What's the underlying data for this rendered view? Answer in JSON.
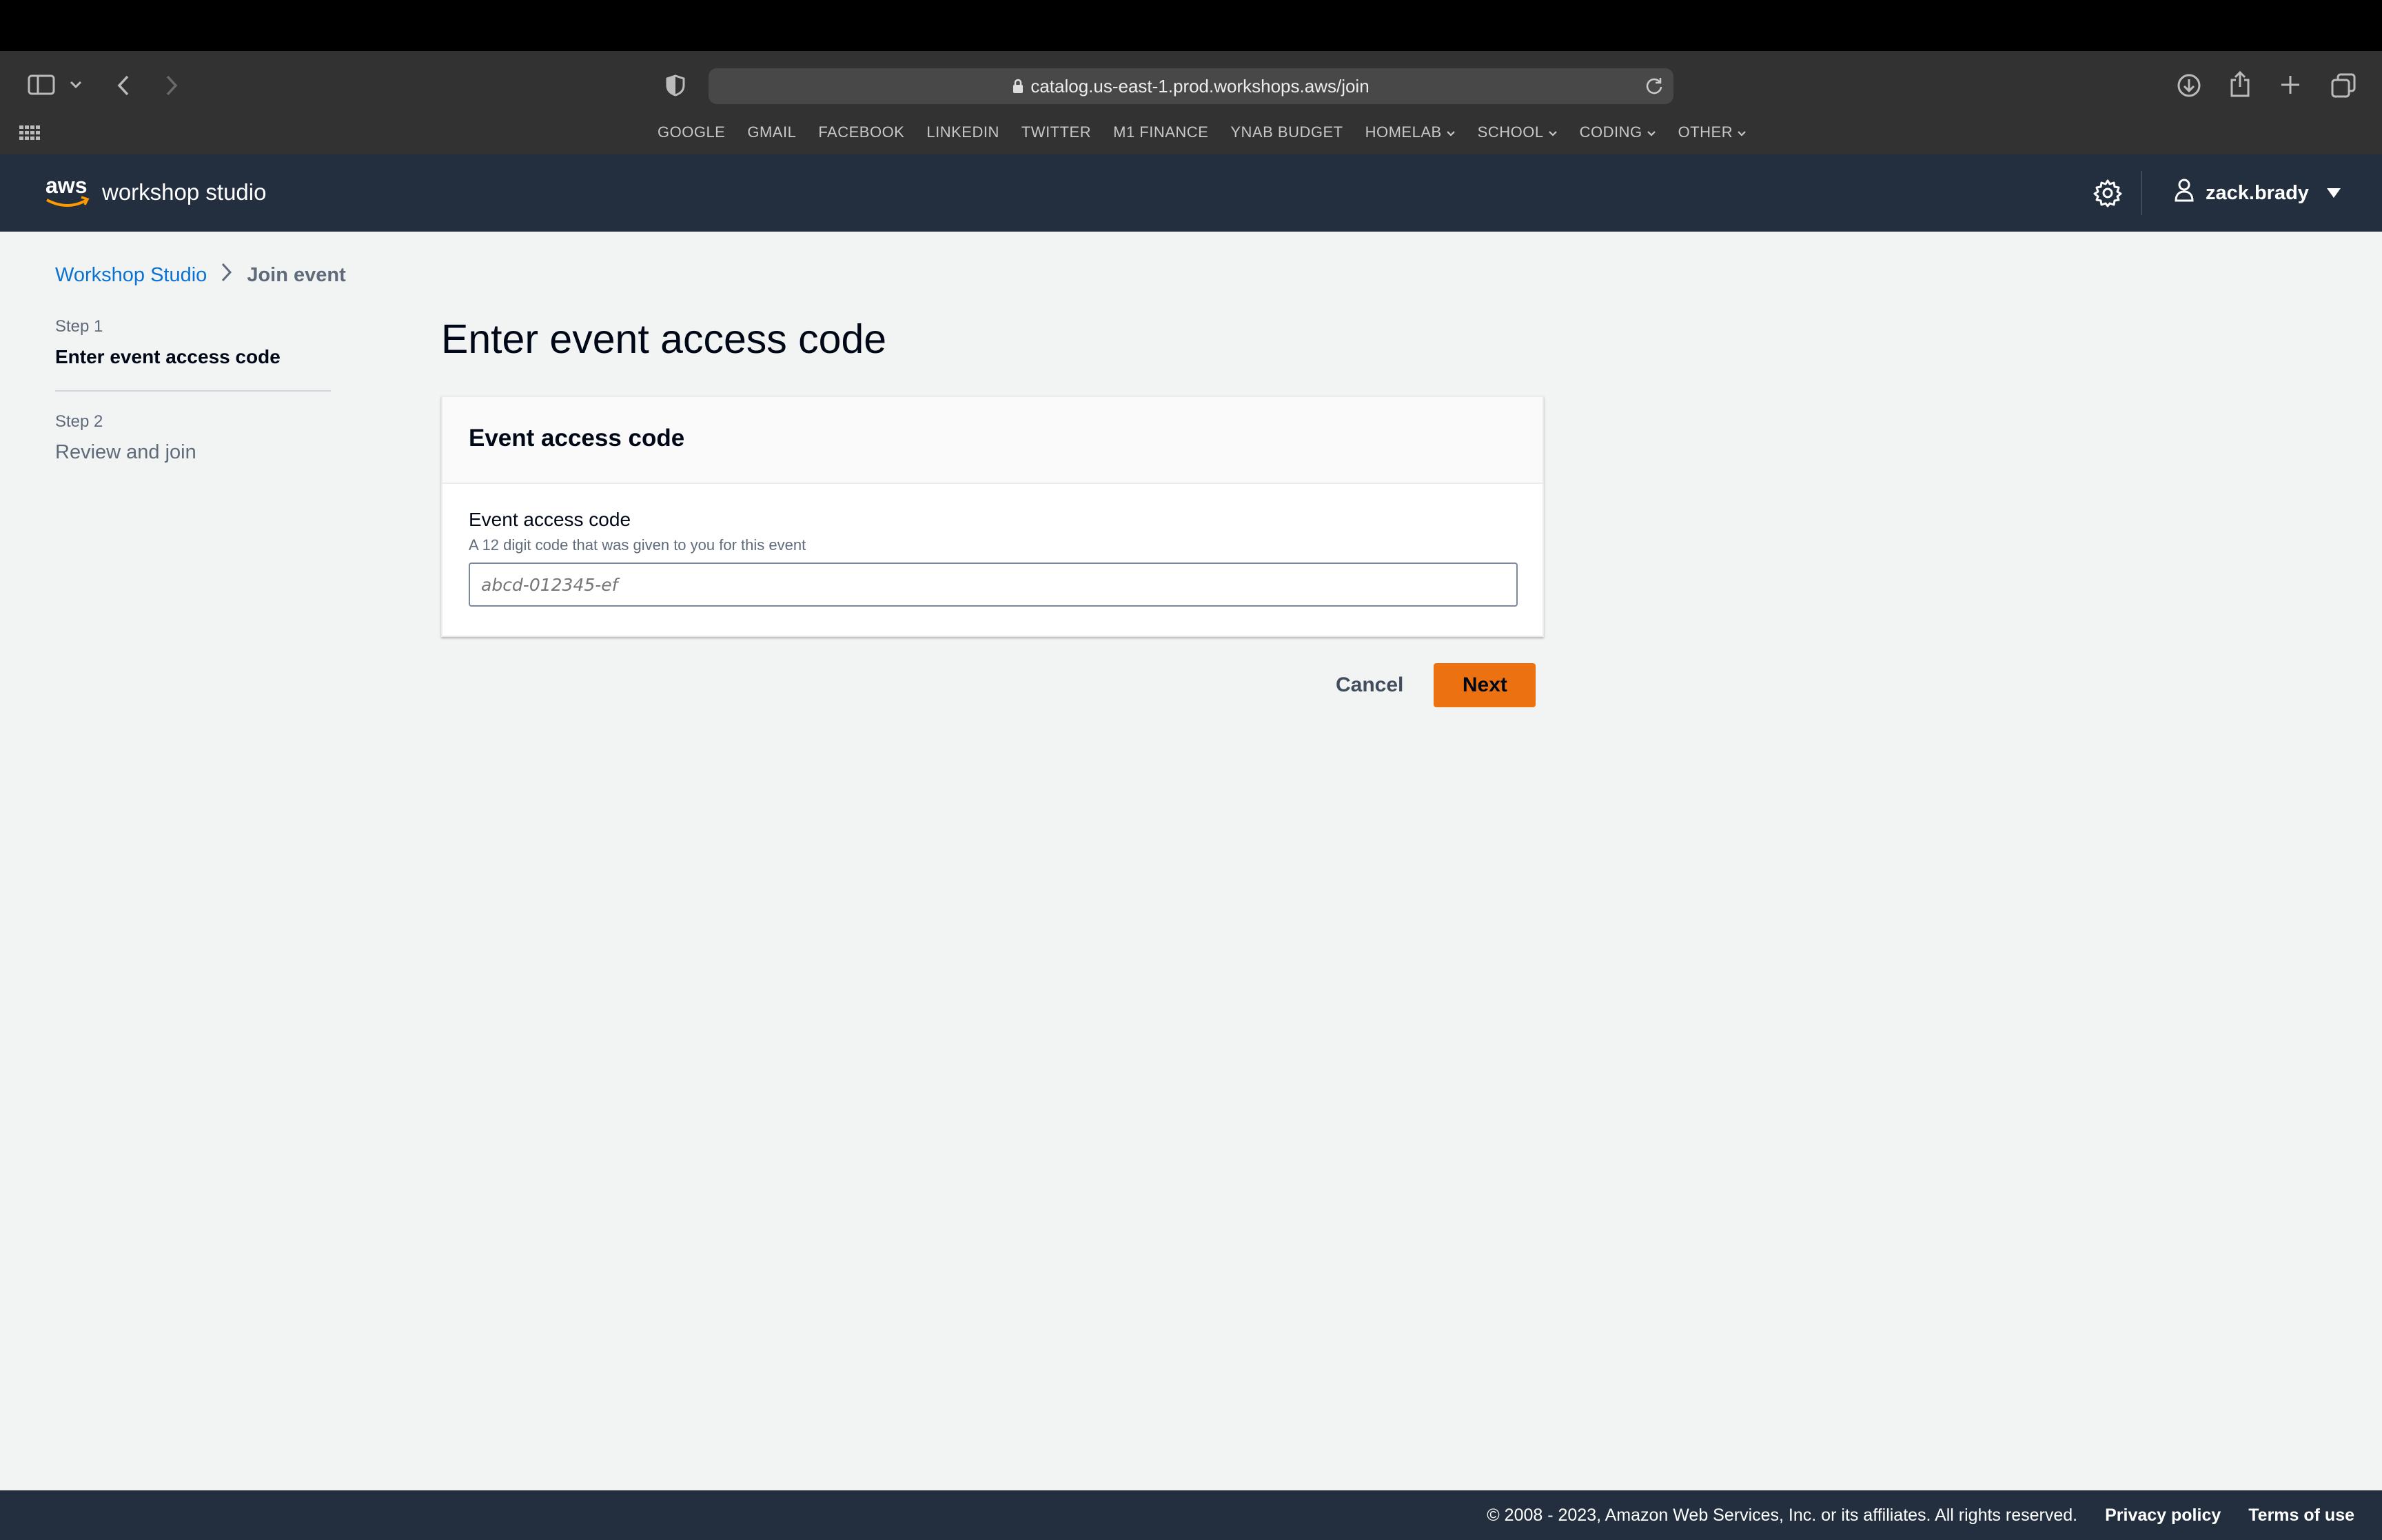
{
  "browser": {
    "url": "catalog.us-east-1.prod.workshops.aws/join",
    "bookmarks": [
      {
        "label": "GOOGLE",
        "dropdown": false
      },
      {
        "label": "GMAIL",
        "dropdown": false
      },
      {
        "label": "FACEBOOK",
        "dropdown": false
      },
      {
        "label": "LINKEDIN",
        "dropdown": false
      },
      {
        "label": "TWITTER",
        "dropdown": false
      },
      {
        "label": "M1 FINANCE",
        "dropdown": false
      },
      {
        "label": "YNAB BUDGET",
        "dropdown": false
      },
      {
        "label": "HOMELAB",
        "dropdown": true
      },
      {
        "label": "SCHOOL",
        "dropdown": true
      },
      {
        "label": "CODING",
        "dropdown": true
      },
      {
        "label": "OTHER",
        "dropdown": true
      }
    ]
  },
  "header": {
    "logo_text": "aws",
    "title": "workshop studio",
    "username": "zack.brady"
  },
  "breadcrumb": {
    "root": "Workshop Studio",
    "current": "Join event"
  },
  "steps": [
    {
      "number": "Step 1",
      "title": "Enter event access code",
      "active": true
    },
    {
      "number": "Step 2",
      "title": "Review and join",
      "active": false
    }
  ],
  "page_title": "Enter event access code",
  "card": {
    "title": "Event access code",
    "field_label": "Event access code",
    "field_description": "A 12 digit code that was given to you for this event",
    "input_value": "",
    "input_placeholder": "abcd-012345-ef"
  },
  "actions": {
    "cancel": "Cancel",
    "next": "Next"
  },
  "footer": {
    "copyright": "© 2008 - 2023, Amazon Web Services, Inc. or its affiliates. All rights reserved.",
    "privacy": "Privacy policy",
    "terms": "Terms of use"
  },
  "colors": {
    "accent": "#ec7211",
    "header_bg": "#232f3e",
    "link": "#0972d3"
  }
}
